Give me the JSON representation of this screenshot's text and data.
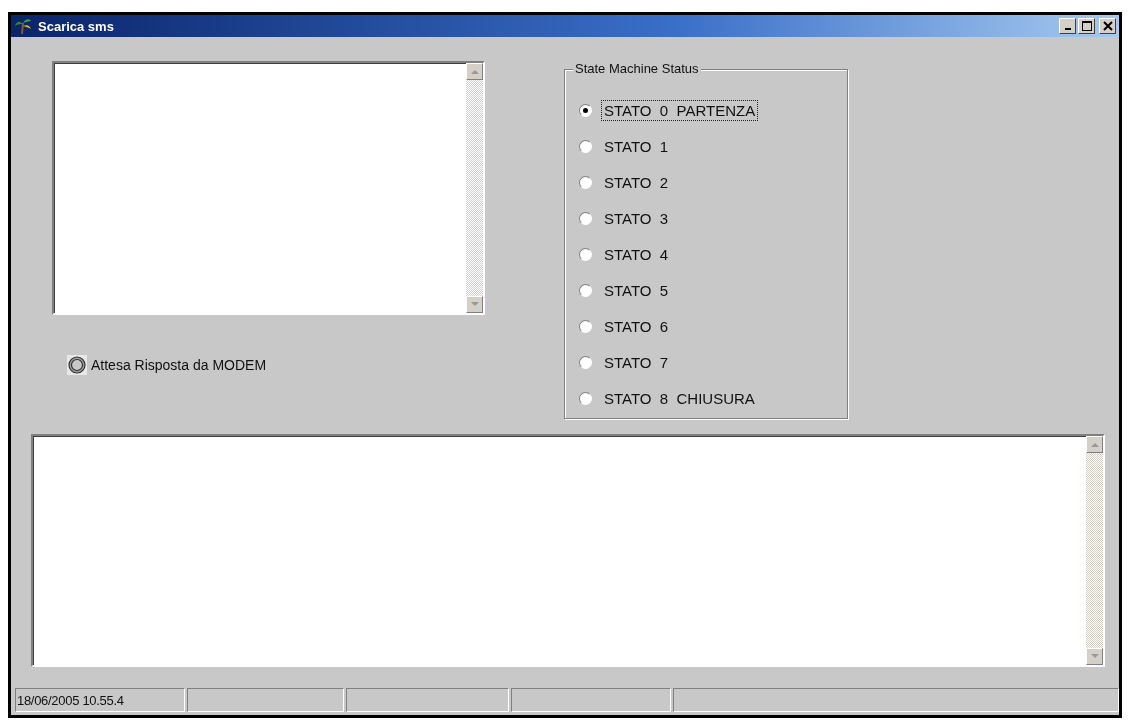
{
  "window": {
    "title": "Scarica sms"
  },
  "indicator": {
    "label": "Attesa Risposta da MODEM"
  },
  "state_group": {
    "title": "State Machine Status",
    "options": [
      {
        "label": "STATO  0  PARTENZA",
        "selected": true
      },
      {
        "label": "STATO  1",
        "selected": false
      },
      {
        "label": "STATO  2",
        "selected": false
      },
      {
        "label": "STATO  3",
        "selected": false
      },
      {
        "label": "STATO  4",
        "selected": false
      },
      {
        "label": "STATO  5",
        "selected": false
      },
      {
        "label": "STATO  6",
        "selected": false
      },
      {
        "label": "STATO  7",
        "selected": false
      },
      {
        "label": "STATO  8  CHIUSURA",
        "selected": false
      }
    ]
  },
  "status_bar": {
    "panels": [
      "18/06/2005 10.55.4"
    ]
  }
}
